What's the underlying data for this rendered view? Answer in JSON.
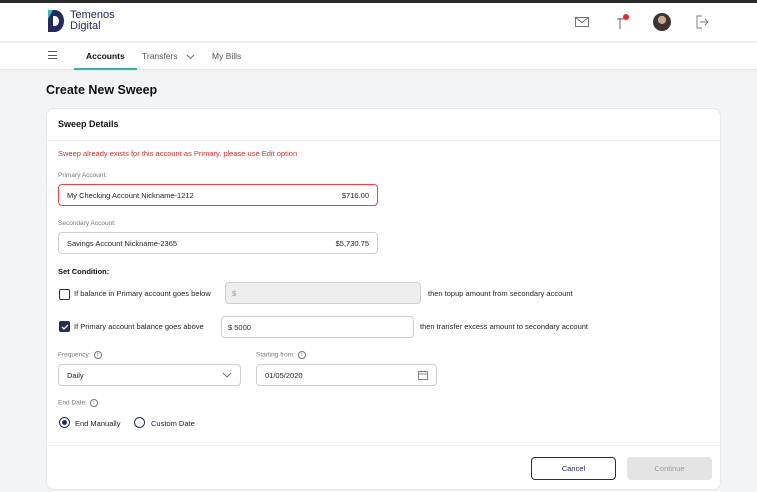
{
  "brand": {
    "line1": "Temenos",
    "line2": "Digital",
    "color": "#232a5c",
    "accent": "#2eb5a0"
  },
  "header_icons": [
    "envelope-icon",
    "notification-flag-icon",
    "avatar",
    "logout-icon"
  ],
  "nav": {
    "tabs": [
      {
        "label": "Accounts",
        "active": true
      },
      {
        "label": "Transfers",
        "has_dropdown": true
      },
      {
        "label": "My Bills"
      }
    ]
  },
  "page_title": "Create New Sweep",
  "card": {
    "title": "Sweep Details",
    "error": "Sweep already exists for this account as Primary, please use Edit option",
    "primary": {
      "label": "Primary Account:",
      "name": "My Checking Account Nickname-1212",
      "amount": "$716.00"
    },
    "secondary": {
      "label": "Secondary Account:",
      "name": "Savings Account Nickname-2365",
      "amount": "$5,730.75"
    },
    "condition": {
      "title": "Set Condition:",
      "below": {
        "checked": false,
        "label": "If balance in Primary account goes below",
        "placeholder": "$",
        "suffix": "then topup amount from secondary account"
      },
      "above": {
        "checked": true,
        "label": "If Primary account balance goes above",
        "value": "$ 5000",
        "suffix": "then transfer excess amount to secondary account"
      }
    },
    "frequency": {
      "label": "Frequency:",
      "value": "Daily"
    },
    "starting": {
      "label": "Starting from:",
      "value": "01/05/2020"
    },
    "end_date": {
      "label": "End Date:",
      "options": [
        {
          "label": "End Manually",
          "selected": true
        },
        {
          "label": "Custom Date",
          "selected": false
        }
      ]
    },
    "buttons": {
      "cancel": "Cancel",
      "continue": "Continue"
    }
  }
}
